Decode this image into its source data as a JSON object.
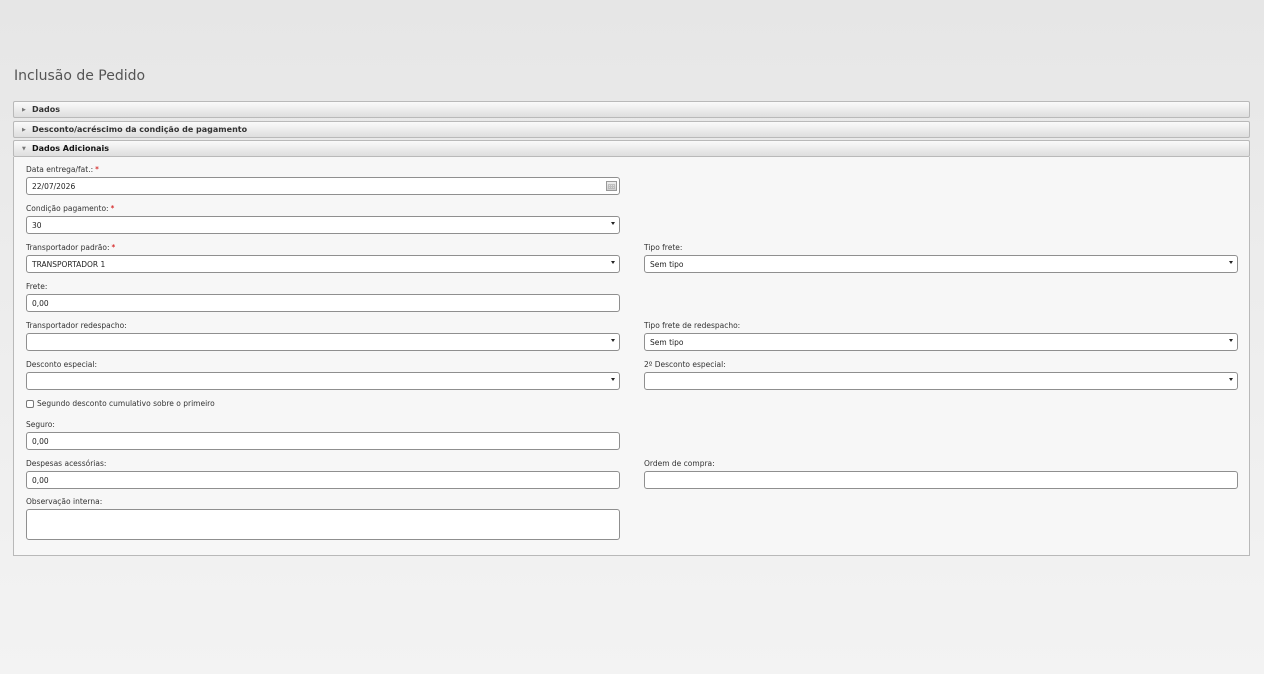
{
  "page": {
    "title": "Inclusão de Pedido"
  },
  "accordion": [
    {
      "label": "Dados",
      "expanded": false
    },
    {
      "label": "Desconto/acréscimo da condição de pagamento",
      "expanded": false
    },
    {
      "label": "Dados Adicionais",
      "expanded": true
    }
  ],
  "form": {
    "required_marker": "*",
    "data_entrega": {
      "label": "Data entrega/fat.:",
      "value": "22/07/2026"
    },
    "condicao_pagamento": {
      "label": "Condição pagamento:",
      "value": "30"
    },
    "transportador_padrao": {
      "label": "Transportador padrão:",
      "value": "TRANSPORTADOR 1"
    },
    "tipo_frete": {
      "label": "Tipo frete:",
      "value": "Sem tipo"
    },
    "frete": {
      "label": "Frete:",
      "value": "0,00"
    },
    "transportador_redespacho": {
      "label": "Transportador redespacho:",
      "value": ""
    },
    "tipo_frete_redespacho": {
      "label": "Tipo frete de redespacho:",
      "value": "Sem tipo"
    },
    "desconto_especial": {
      "label": "Desconto especial:",
      "value": ""
    },
    "desconto_especial_2": {
      "label": "2º Desconto especial:",
      "value": ""
    },
    "segundo_desconto_cumulativo": {
      "label": "Segundo desconto cumulativo sobre o primeiro",
      "checked": false
    },
    "seguro": {
      "label": "Seguro:",
      "value": "0,00"
    },
    "despesas_acessorias": {
      "label": "Despesas acessórias:",
      "value": "0,00"
    },
    "ordem_compra": {
      "label": "Ordem de compra:",
      "value": ""
    },
    "observacao_interna": {
      "label": "Observação interna:",
      "value": ""
    }
  },
  "icons": {
    "collapsed": "triangle-right-icon",
    "expanded": "triangle-down-icon",
    "dropdown": "chevron-down-icon",
    "calendar": "calendar-icon"
  },
  "colors": {
    "required": "#d00000"
  }
}
